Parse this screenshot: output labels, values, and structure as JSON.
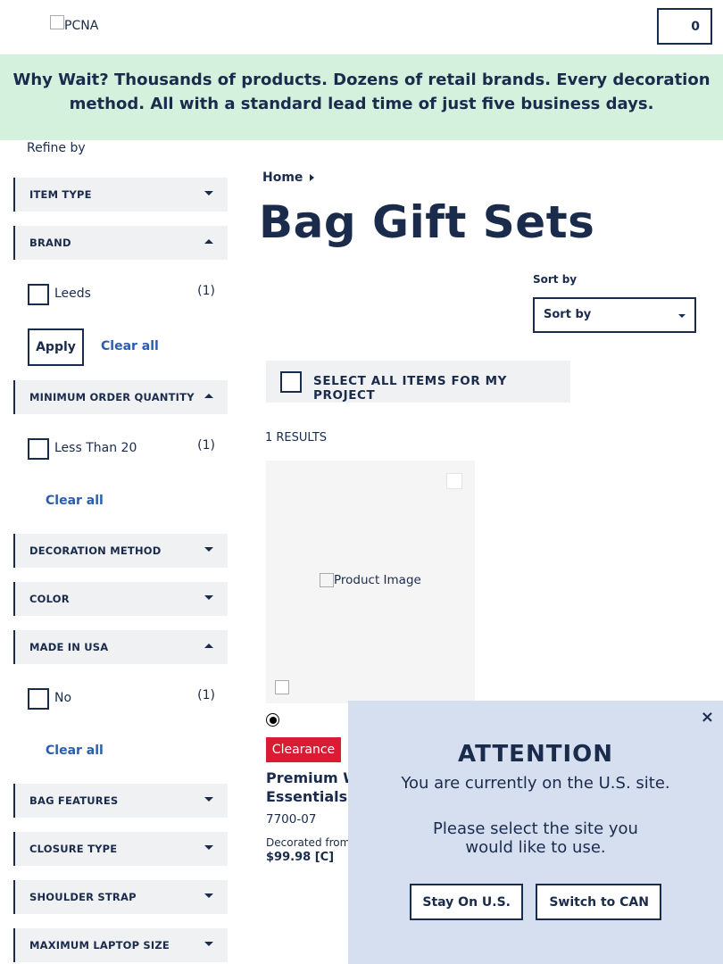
{
  "header": {
    "logo_alt": "PCNA",
    "cart_count": "0"
  },
  "banner": {
    "lead": "Why Wait?",
    "text": " Thousands of products. Dozens of retail brands. Every decoration method. All with a standard lead time of just five business days."
  },
  "sidebar": {
    "refine_label": "Refine by",
    "facets": {
      "item_type": "ITEM TYPE",
      "brand": "BRAND",
      "min_qty": "MINIMUM ORDER QUANTITY",
      "decoration": "DECORATION METHOD",
      "color": "COLOR",
      "made_in_usa": "MADE IN USA",
      "bag_features": "BAG FEATURES",
      "closure": "CLOSURE TYPE",
      "shoulder": "SHOULDER STRAP",
      "laptop": "MAXIMUM LAPTOP SIZE"
    },
    "brand_option": {
      "label": "Leeds",
      "count": "(1)"
    },
    "qty_option": {
      "label": "Less Than 20",
      "count": "(1)"
    },
    "usa_option": {
      "label": "No",
      "count": "(1)"
    },
    "apply_label": "Apply",
    "clear_all": "Clear all"
  },
  "main": {
    "breadcrumb_home": "Home",
    "title": "Bag Gift Sets",
    "sort_label": "Sort by",
    "sort_value": "Sort by",
    "select_all": "SELECT ALL ITEMS FOR MY PROJECT",
    "results": "1 RESULTS",
    "product": {
      "image_alt": "Product Image",
      "badge": "Clearance",
      "name_line1": "Premium Weekender",
      "name_line2": "Essentials",
      "sku": "7700-07",
      "decorated_from": "Decorated from",
      "price": "$99.98 [C]"
    }
  },
  "modal": {
    "close": "×",
    "heading": "ATTENTION",
    "message1": "You are currently on the U.S. site.",
    "message2": "Please select the site you would like to use.",
    "stay_label": "Stay On U.S.",
    "switch_label": "Switch to CAN"
  },
  "colors": {
    "navy": "#1a2b4c",
    "banner_bg": "#d4f1de",
    "facet_bg": "#f0f1f3",
    "link": "#2a5db0",
    "clearance_red": "#d91c33",
    "modal_bg": "#d5dff0"
  }
}
